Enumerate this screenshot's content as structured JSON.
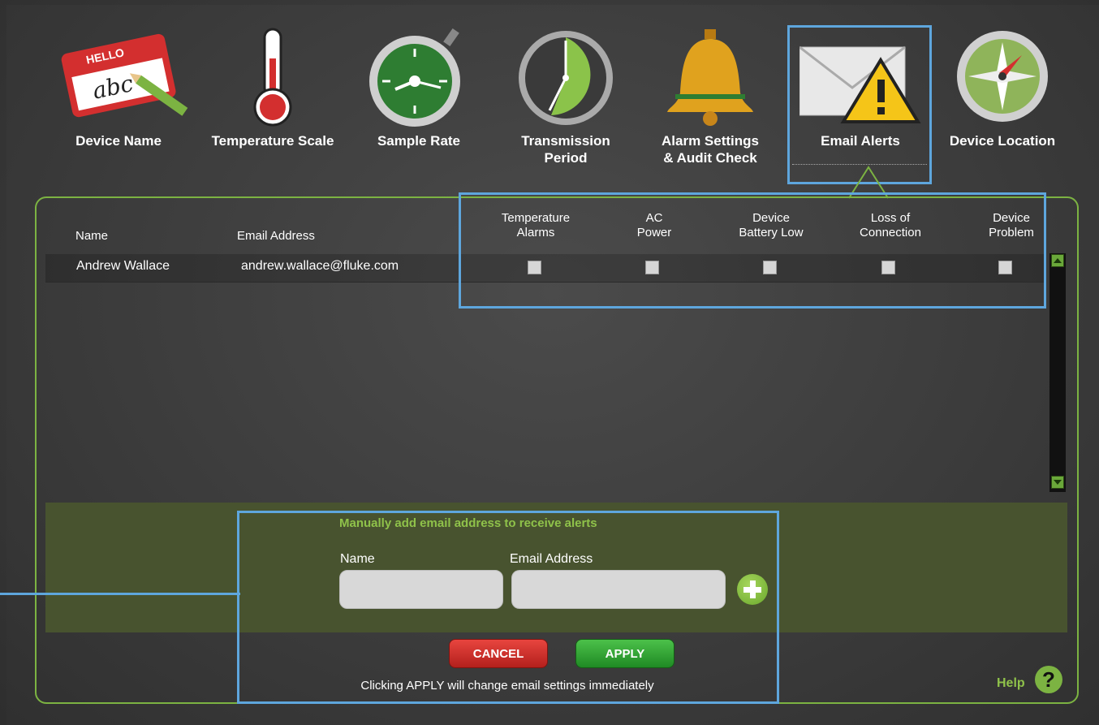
{
  "nav": {
    "items": [
      {
        "label": "Device Name",
        "icon": "name-tag-icon"
      },
      {
        "label": "Temperature Scale",
        "icon": "thermometer-icon"
      },
      {
        "label": "Sample Rate",
        "icon": "stopwatch-icon"
      },
      {
        "label": "Transmission\nPeriod",
        "icon": "clock-icon"
      },
      {
        "label": "Alarm Settings\n& Audit Check",
        "icon": "bell-icon"
      },
      {
        "label": "Email Alerts",
        "icon": "email-warning-icon",
        "selected": true
      },
      {
        "label": "Device Location",
        "icon": "compass-icon"
      }
    ],
    "name_tag_hello": "HELLO",
    "name_tag_text": "abc"
  },
  "table": {
    "headers": {
      "name": "Name",
      "email": "Email Address",
      "temp_alarms": "Temperature\nAlarms",
      "ac_power": "AC\nPower",
      "battery_low": "Device\nBattery Low",
      "loss_connection": "Loss of\nConnection",
      "device_problem": "Device\nProblem"
    },
    "rows": [
      {
        "name": "Andrew Wallace",
        "email": "andrew.wallace@fluke.com",
        "temp_alarms": false,
        "ac_power": false,
        "battery_low": false,
        "loss_connection": false,
        "device_problem": false
      }
    ]
  },
  "add_form": {
    "title": "Manually add email address to receive alerts",
    "name_label": "Name",
    "email_label": "Email Address",
    "name_value": "",
    "email_value": ""
  },
  "buttons": {
    "cancel": "CANCEL",
    "apply": "APPLY"
  },
  "note": "Clicking APPLY will change email settings immediately",
  "help": "Help",
  "colors": {
    "accent_green": "#7cb342",
    "highlight_blue": "#5ea6dd",
    "cancel_red": "#c62828",
    "apply_green": "#2e9e2f"
  }
}
